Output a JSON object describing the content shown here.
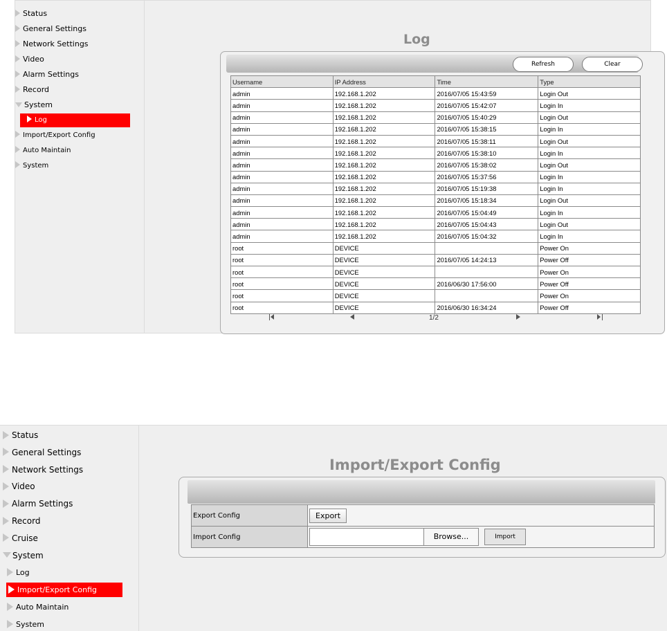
{
  "screen1": {
    "menu": [
      {
        "label": "Status",
        "type": "top"
      },
      {
        "label": "General Settings",
        "type": "top"
      },
      {
        "label": "Network Settings",
        "type": "top"
      },
      {
        "label": "Video",
        "type": "top"
      },
      {
        "label": "Alarm Settings",
        "type": "top"
      },
      {
        "label": "Record",
        "type": "top"
      },
      {
        "label": "System",
        "type": "open"
      },
      {
        "label": "Log",
        "type": "active"
      },
      {
        "label": "Import/Export Config",
        "type": "sub"
      },
      {
        "label": "Auto Maintain",
        "type": "sub"
      },
      {
        "label": "System",
        "type": "sub"
      }
    ],
    "title": "Log",
    "refresh_label": "Refresh",
    "clear_label": "Clear",
    "columns": [
      "Username",
      "IP Address",
      "Time",
      "Type"
    ],
    "rows": [
      [
        "admin",
        "192.168.1.202",
        "2016/07/05 15:43:59",
        "Login Out"
      ],
      [
        "admin",
        "192.168.1.202",
        "2016/07/05 15:42:07",
        "Login In"
      ],
      [
        "admin",
        "192.168.1.202",
        "2016/07/05 15:40:29",
        "Login Out"
      ],
      [
        "admin",
        "192.168.1.202",
        "2016/07/05 15:38:15",
        "Login In"
      ],
      [
        "admin",
        "192.168.1.202",
        "2016/07/05 15:38:11",
        "Login Out"
      ],
      [
        "admin",
        "192.168.1.202",
        "2016/07/05 15:38:10",
        "Login In"
      ],
      [
        "admin",
        "192.168.1.202",
        "2016/07/05 15:38:02",
        "Login Out"
      ],
      [
        "admin",
        "192.168.1.202",
        "2016/07/05 15:37:56",
        "Login In"
      ],
      [
        "admin",
        "192.168.1.202",
        "2016/07/05 15:19:38",
        "Login In"
      ],
      [
        "admin",
        "192.168.1.202",
        "2016/07/05 15:18:34",
        "Login Out"
      ],
      [
        "admin",
        "192.168.1.202",
        "2016/07/05 15:04:49",
        "Login In"
      ],
      [
        "admin",
        "192.168.1.202",
        "2016/07/05 15:04:43",
        "Login Out"
      ],
      [
        "admin",
        "192.168.1.202",
        "2016/07/05 15:04:32",
        "Login In"
      ],
      [
        "root",
        "DEVICE",
        "",
        "Power On"
      ],
      [
        "root",
        "DEVICE",
        "2016/07/05 14:24:13",
        "Power Off"
      ],
      [
        "root",
        "DEVICE",
        "",
        "Power On"
      ],
      [
        "root",
        "DEVICE",
        "2016/06/30 17:56:00",
        "Power Off"
      ],
      [
        "root",
        "DEVICE",
        "",
        "Power On"
      ],
      [
        "root",
        "DEVICE",
        "2016/06/30 16:34:24",
        "Power Off"
      ]
    ],
    "pager": {
      "current": "1/2"
    }
  },
  "screen2": {
    "menu": [
      {
        "label": "Status",
        "type": "top"
      },
      {
        "label": "General Settings",
        "type": "top"
      },
      {
        "label": "Network Settings",
        "type": "top"
      },
      {
        "label": "Video",
        "type": "top"
      },
      {
        "label": "Alarm Settings",
        "type": "top"
      },
      {
        "label": "Record",
        "type": "top"
      },
      {
        "label": "Cruise",
        "type": "top"
      },
      {
        "label": "System",
        "type": "open"
      },
      {
        "label": "Log",
        "type": "sub"
      },
      {
        "label": "Import/Export Config",
        "type": "active"
      },
      {
        "label": "Auto Maintain",
        "type": "sub"
      },
      {
        "label": "System",
        "type": "sub"
      }
    ],
    "title": "Import/Export Config",
    "export_row_label": "Export Config",
    "export_button": "Export",
    "import_row_label": "Import Config",
    "file_value": "",
    "browse_button": "Browse...",
    "import_button": "Import"
  },
  "colors": {
    "active": "#ff0000",
    "title": "#8c8c8c",
    "panel_bg": "#efefef"
  },
  "icons": {
    "menu_arrow": "triangle-right-icon",
    "menu_open": "triangle-down-icon",
    "pager_first": "first-page-icon",
    "pager_prev": "prev-page-icon",
    "pager_next": "next-page-icon",
    "pager_last": "last-page-icon"
  }
}
